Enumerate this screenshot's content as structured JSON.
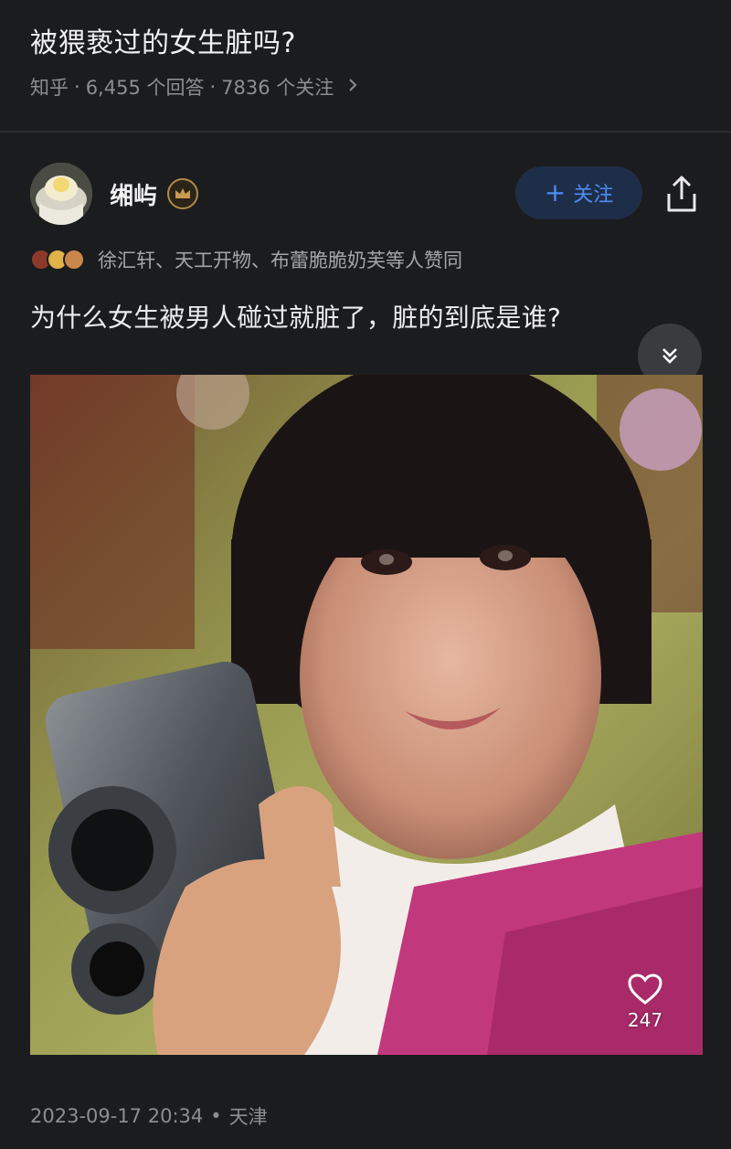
{
  "question": {
    "title": "被猥亵过的女生脏吗?",
    "source": "知乎",
    "answers_count": "6,455 个回答",
    "followers_count": "7836 个关注",
    "separator": "·",
    "more_icon": "chevron-right-icon"
  },
  "answer": {
    "author": {
      "name": "缃屿",
      "badge_icon": "crown-badge-icon"
    },
    "follow_button": {
      "label": "关注",
      "icon": "plus-icon",
      "color": "#4d8df5"
    },
    "share_icon": "share-icon",
    "upvoters": {
      "text": "徐汇轩、天工开物、布蕾脆脆奶芙等人赞同"
    },
    "excerpt": "为什么女生被男人碰过就脏了，脏的到底是谁?",
    "expand_icon": "double-chevron-down-icon",
    "image": {
      "like_icon": "heart-outline-icon",
      "like_count": "247"
    },
    "footer": {
      "datetime": "2023-09-17 20:34",
      "separator": "•",
      "location": "天津"
    }
  },
  "colors": {
    "background": "#1b1c1e",
    "accent": "#4d8df5",
    "follow_bg": "#1f2e48",
    "muted_text": "#8d8e92"
  }
}
